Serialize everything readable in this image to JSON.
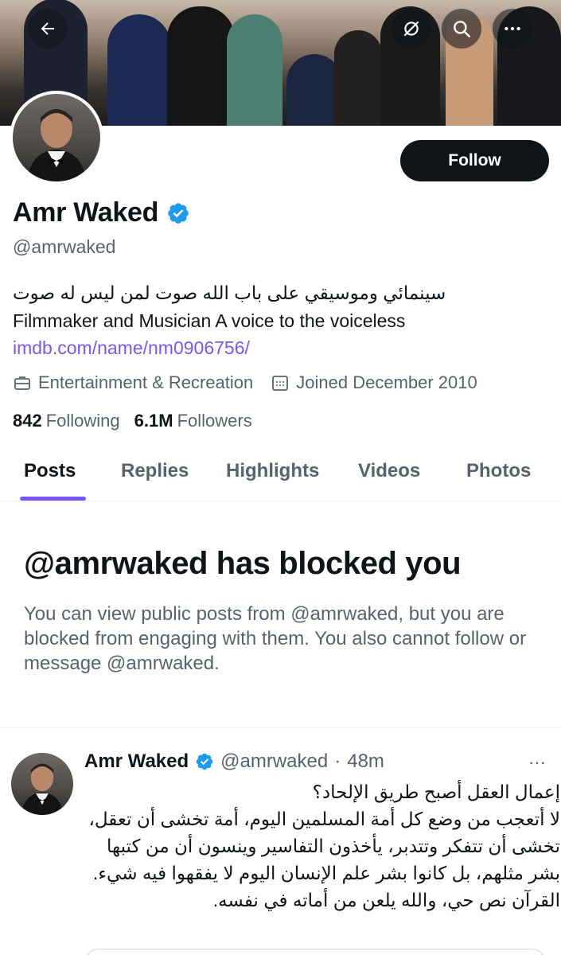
{
  "header": {
    "back_icon": "arrow-left-icon",
    "actions": [
      "mute-icon",
      "search-icon",
      "more-icon"
    ]
  },
  "profile": {
    "display_name": "Amr Waked",
    "verified_icon": "verified-badge-icon",
    "handle": "@amrwaked",
    "follow_label": "Follow",
    "bio_arabic": "سينمائي وموسيقي على باب الله صوت لمن ليس له صوت",
    "bio_english": "Filmmaker and Musician A voice to the voiceless",
    "link": "imdb.com/name/nm0906756/",
    "category": "Entertainment & Recreation",
    "joined": "Joined December 2010",
    "following_count": "842",
    "following_label": "Following",
    "followers_count": "6.1M",
    "followers_label": "Followers"
  },
  "tabs": [
    "Posts",
    "Replies",
    "Highlights",
    "Videos",
    "Photos"
  ],
  "active_tab": "Posts",
  "blocked": {
    "title": "@amrwaked has blocked you",
    "description": "You can view public posts from @amrwaked, but you are blocked from engaging with them. You also cannot follow or message @amrwaked."
  },
  "post": {
    "name": "Amr Waked",
    "handle": "@amrwaked",
    "separator": "·",
    "time": "48m",
    "more_label": "···",
    "text": "إعمال العقل أصبح طريق الإلحاد؟\nلا أتعجب من وضع كل أمة المسلمين اليوم، أمة تخشى أن تعقل، تخشى أن تتفكر وتتدبر، يأخذون التفاسير وينسون أن من كتبها بشر مثلهم، بل كانوا بشر علم الإنسان اليوم لا يفقهوا فيه شيء.\nالقرآن نص حي، والله يلعن من أماته في نفسه."
  },
  "colors": {
    "text": "#0f1419",
    "secondary": "#536471",
    "accent": "#7856ff",
    "verified": "#1d9bf0",
    "button": "#0f1419"
  }
}
